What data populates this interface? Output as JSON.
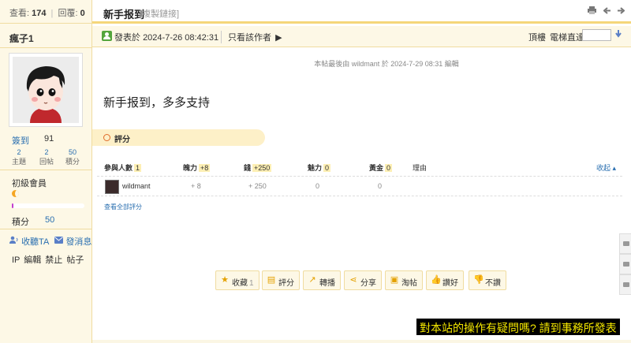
{
  "sidebar": {
    "stats_views_label": "查看:",
    "stats_views": "174",
    "stats_replies_label": "回覆:",
    "stats_replies": "0",
    "username": "瘋子1",
    "checkin_label": "簽到",
    "checkin_value": "91",
    "stats": [
      {
        "value": "2",
        "label": "主題"
      },
      {
        "value": "2",
        "label": "回帖"
      },
      {
        "value": "50",
        "label": "積分"
      }
    ],
    "level": "初級會員",
    "level_progress": 0.02,
    "points_label": "積分",
    "points_value": "50",
    "follow_label": "收聽TA",
    "message_label": "發消息",
    "admin_links": "IP 編輯 禁止 帖子"
  },
  "thread": {
    "title": "新手报到",
    "copy_link": "[複製鏈接]",
    "posted_prefix": "發表於",
    "posted_time": "2024-7-26 08:42:31",
    "author_only": "只看該作者",
    "top_floor": "頂樓",
    "elevator": "電梯直達",
    "edit_note": "本帖最後由 wildmant 於 2024-7-29 08:31 編輯",
    "content": "新手报到，多多支持"
  },
  "rating": {
    "label": "評分",
    "headers": {
      "participants": "參與人數",
      "participants_count": "1",
      "charm": "魄力",
      "charm_total": "+8",
      "money": "錢",
      "money_total": "+250",
      "appeal": "魅力",
      "appeal_total": "0",
      "gold": "黃金",
      "gold_total": "0",
      "reason": "理由",
      "collapse": "收起"
    },
    "rows": [
      {
        "user": "wildmant",
        "charm": "+ 8",
        "money": "+ 250",
        "appeal": "0",
        "gold": "0",
        "reason": ""
      }
    ],
    "view_all": "查看全部評分"
  },
  "actions": {
    "favorite": "收藏",
    "favorite_count": "1",
    "rate": "評分",
    "repost": "轉播",
    "share": "分享",
    "taobao": "淘帖",
    "like": "讚好",
    "dislike": "不讚"
  },
  "banner": "對本站的操作有疑問嗎? 請到事務所發表",
  "colors": {
    "accent_yellow": "#f5d67a",
    "panel_bg": "#fdf8e6",
    "link_blue": "#2a6fb0",
    "banner_bg": "#000000",
    "banner_text": "#f5e800"
  }
}
